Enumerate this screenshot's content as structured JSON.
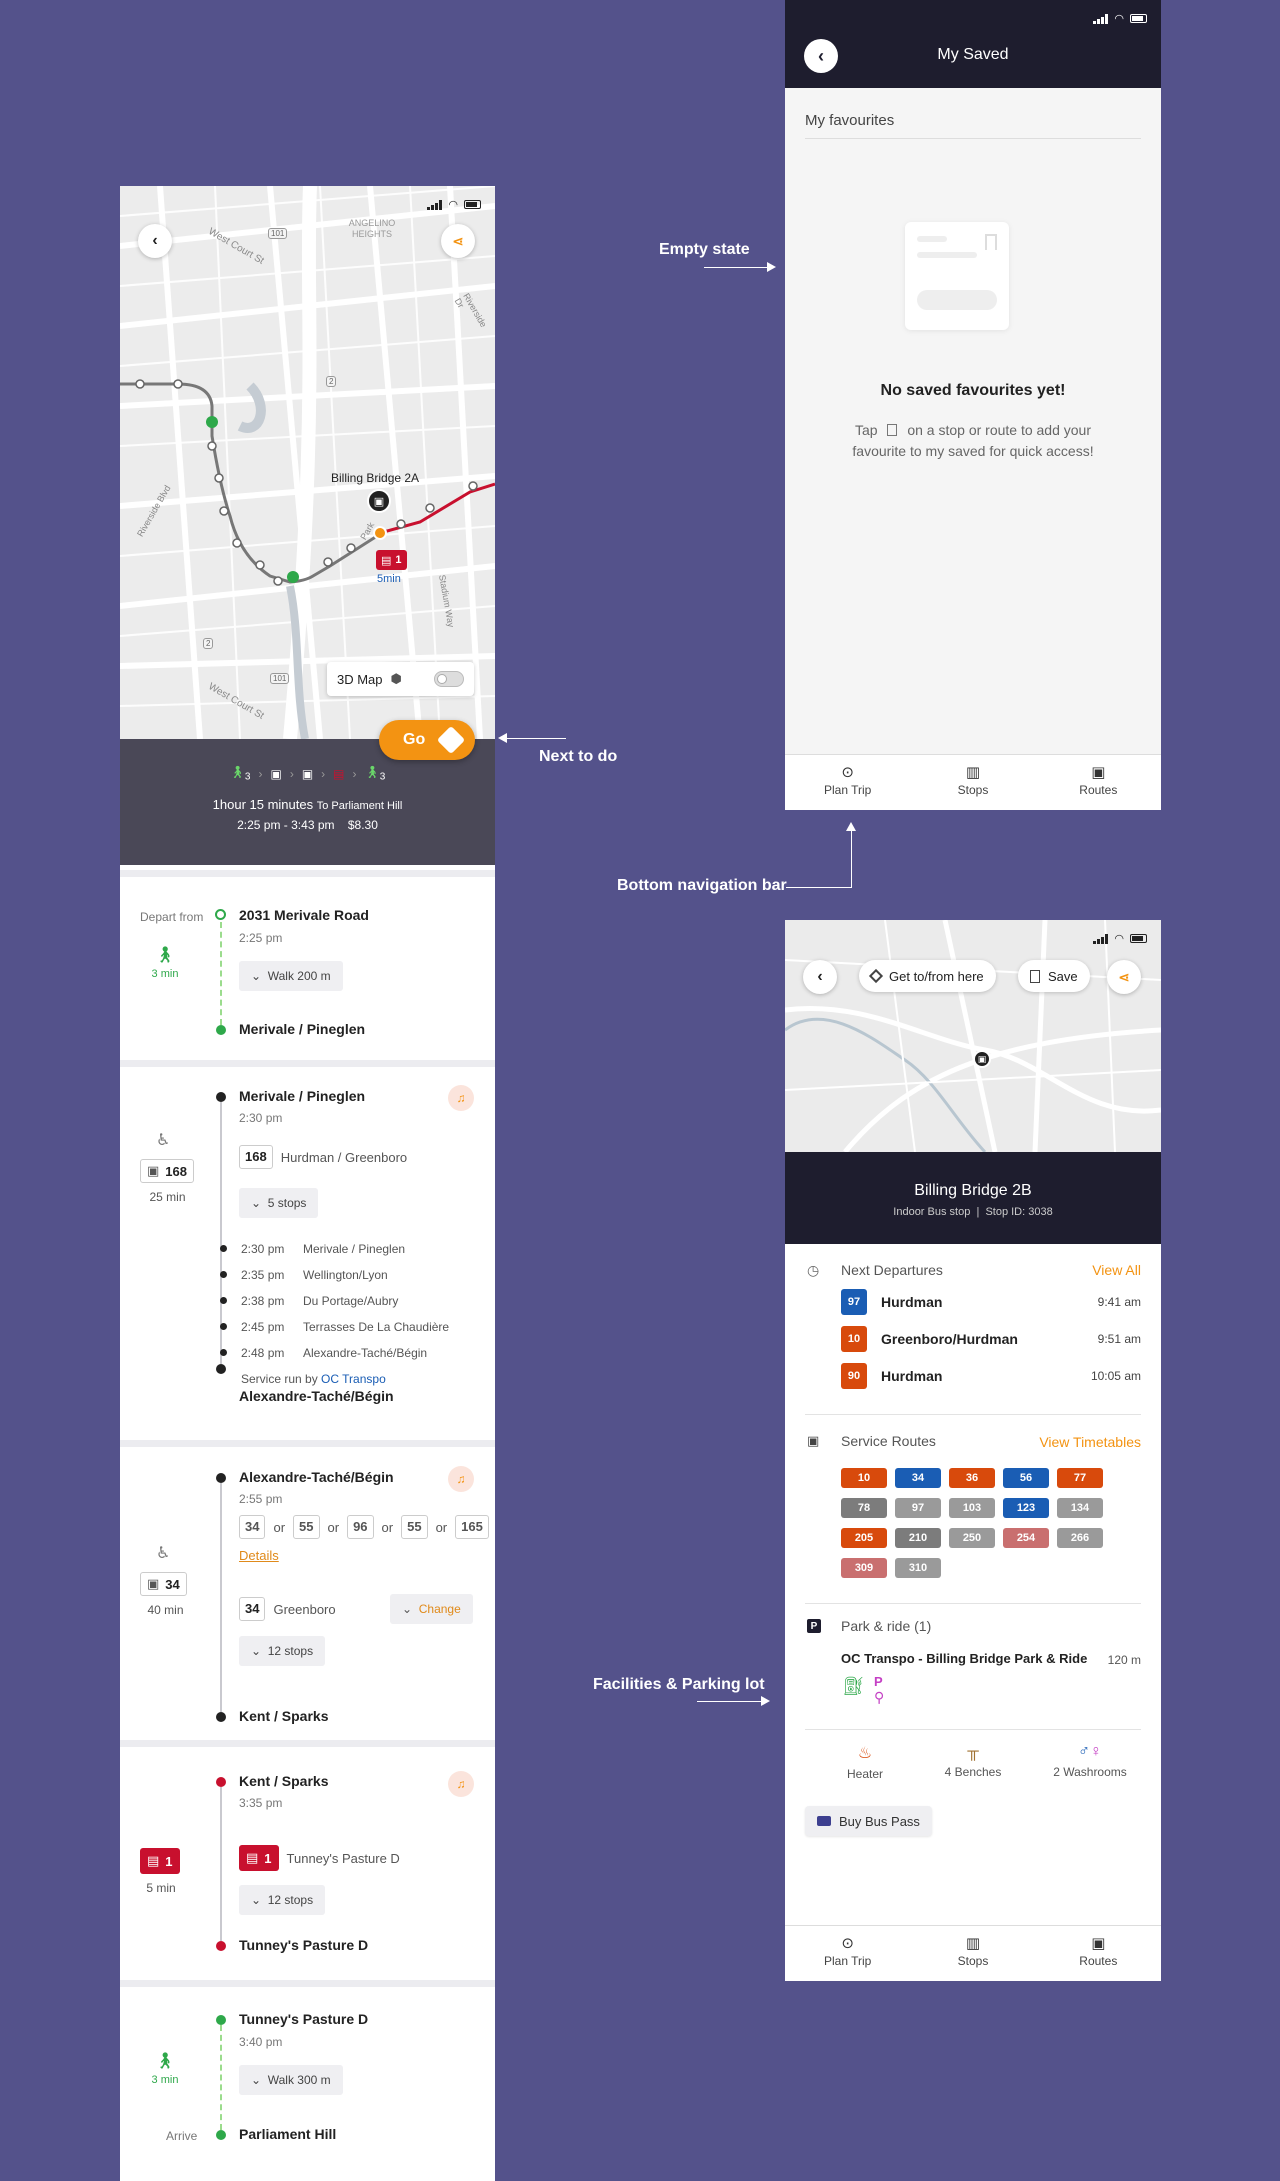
{
  "colors": {
    "background": "#54528b",
    "accent": "#f39312",
    "dark": "#1e1d2e",
    "red": "#c8102e",
    "green": "#2ea84a",
    "blue": "#1a5db4",
    "orange_route": "#d84a0c",
    "grey_route": "#7c7c7c",
    "pink_route": "#c96f6f"
  },
  "annotations": {
    "empty_state": "Empty state",
    "next_to_do": "Next to do",
    "bottom_nav": "Bottom navigation bar",
    "facilities": "Facilities & Parking lot"
  },
  "trip": {
    "map": {
      "stop_label": "Billing Bridge 2A",
      "bus_badge": "1",
      "bus_eta": "5min",
      "map3d_label": "3D Map",
      "street_labels": [
        "West Court St",
        "ANGELINO HEIGHTS",
        "West Court St",
        "Riverside Dr",
        "Park",
        "Stadium Way",
        "Riverside Blvd"
      ],
      "road_shields": [
        "101",
        "101",
        "101",
        "2",
        "2"
      ]
    },
    "go_label": "Go",
    "summary": {
      "walk1": "3",
      "walk2": "3",
      "duration": "1hour 15 minutes",
      "destination": "To Parliament Hill",
      "times": "2:25 pm - 3:43 pm",
      "fare": "$8.30"
    },
    "walk1": {
      "depart_label": "Depart from",
      "from": "2031 Merivale Road",
      "time": "2:25 pm",
      "duration": "3 min",
      "walk": "Walk 200 m",
      "to": "Merivale / Pineglen"
    },
    "bus168": {
      "from": "Merivale / Pineglen",
      "time": "2:30 pm",
      "route": "168",
      "headsign": "Hurdman / Greenboro",
      "duration": "25 min",
      "stops_toggle": "5 stops",
      "stops": [
        {
          "time": "2:30 pm",
          "name": "Merivale / Pineglen"
        },
        {
          "time": "2:35 pm",
          "name": "Wellington/Lyon"
        },
        {
          "time": "2:38 pm",
          "name": "Du Portage/Aubry"
        },
        {
          "time": "2:45 pm",
          "name": "Terrasses De La Chaudière"
        },
        {
          "time": "2:48 pm",
          "name": "Alexandre-Taché/Bégin"
        }
      ],
      "service_prefix": "Service run by",
      "service_link": "OC Transpo",
      "to": "Alexandre-Taché/Bégin"
    },
    "bus34": {
      "from": "Alexandre-Taché/Bégin",
      "time": "2:55 pm",
      "alternatives": [
        "34",
        "55",
        "96",
        "55",
        "165"
      ],
      "or": "or",
      "details": "Details",
      "route": "34",
      "headsign": "Greenboro",
      "change": "Change",
      "duration": "40 min",
      "stops_toggle": "12 stops",
      "to": "Kent / Sparks"
    },
    "train1": {
      "from": "Kent / Sparks",
      "time": "3:35 pm",
      "route": "1",
      "headsign": "Tunney's Pasture D",
      "duration": "5 min",
      "stops_toggle": "12 stops",
      "to": "Tunney's Pasture D"
    },
    "walk2": {
      "from": "Tunney's Pasture D",
      "time": "3:40 pm",
      "duration": "3 min",
      "walk": "Walk 300 m",
      "arrive_label": "Arrive",
      "to": "Parliament Hill"
    }
  },
  "saved": {
    "title": "My Saved",
    "section": "My favourites",
    "empty_title": "No saved favourites yet!",
    "empty_line1_a": "Tap",
    "empty_line1_b": "on a stop or route to add your",
    "empty_line2": "favourite to my saved for quick access!"
  },
  "nav": {
    "plan": "Plan Trip",
    "stops": "Stops",
    "routes": "Routes"
  },
  "stop": {
    "get_to": "Get to/from here",
    "save": "Save",
    "name": "Billing Bridge 2B",
    "type": "Indoor Bus stop",
    "stop_id": "Stop ID: 3038",
    "next_departures": "Next Departures",
    "view_all": "View All",
    "departures": [
      {
        "route": "97",
        "dest": "Hurdman",
        "time": "9:41 am",
        "color": "#1a5db4"
      },
      {
        "route": "10",
        "dest": "Greenboro/Hurdman",
        "time": "9:51 am",
        "color": "#d84a0c"
      },
      {
        "route": "90",
        "dest": "Hurdman",
        "time": "10:05 am",
        "color": "#d84a0c"
      }
    ],
    "service_routes": "Service Routes",
    "view_timetables": "View Timetables",
    "routes": [
      {
        "n": "10",
        "c": "#d84a0c"
      },
      {
        "n": "34",
        "c": "#1a5db4"
      },
      {
        "n": "36",
        "c": "#d84a0c"
      },
      {
        "n": "56",
        "c": "#1a5db4"
      },
      {
        "n": "77",
        "c": "#d84a0c"
      },
      {
        "n": "78",
        "c": "#7c7c7c"
      },
      {
        "n": "97",
        "c": "#9a9a9a"
      },
      {
        "n": "103",
        "c": "#9a9a9a"
      },
      {
        "n": "123",
        "c": "#1a5db4"
      },
      {
        "n": "134",
        "c": "#9a9a9a"
      },
      {
        "n": "205",
        "c": "#d84a0c"
      },
      {
        "n": "210",
        "c": "#7c7c7c"
      },
      {
        "n": "250",
        "c": "#9a9a9a"
      },
      {
        "n": "254",
        "c": "#c96f6f"
      },
      {
        "n": "266",
        "c": "#9a9a9a"
      },
      {
        "n": "309",
        "c": "#c96f6f"
      },
      {
        "n": "310",
        "c": "#9a9a9a"
      }
    ],
    "park_ride": "Park & ride (1)",
    "park_name": "OC Transpo - Billing Bridge Park & Ride",
    "park_dist": "120 m",
    "amenities": {
      "heater": "Heater",
      "benches": "4 Benches",
      "washrooms": "2 Washrooms"
    },
    "buy_pass": "Buy Bus Pass"
  }
}
